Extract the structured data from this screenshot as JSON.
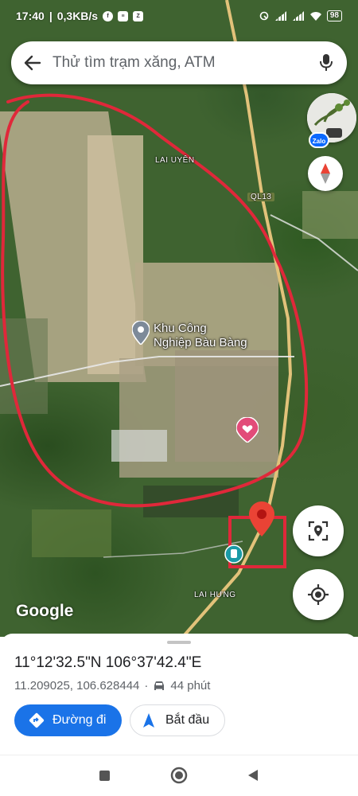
{
  "status_bar": {
    "time": "17:40",
    "network_speed": "0,3KB/s",
    "notification_icons": [
      "facebook-icon",
      "message-icon",
      "zalo-icon"
    ],
    "battery": "98"
  },
  "search": {
    "placeholder": "Thử tìm trạm xăng, ATM"
  },
  "map": {
    "labels": {
      "village_top": "LAI UYÊN",
      "highway": "QL13",
      "industrial_park": "Khu Công\nNghiệp Bàu Bàng",
      "village_bottom": "LAI HƯNG",
      "google": "Google"
    },
    "annotation_color": "#e0283a",
    "pin_color": "#ea4335"
  },
  "thumbnail": {
    "badge": "Zalo"
  },
  "place": {
    "dms": "11°12'32.5\"N 106°37'42.4\"E",
    "decimal": "11.209025, 106.628444",
    "travel_time": "44 phút"
  },
  "actions": {
    "directions_label": "Đường đi",
    "start_label": "Bắt đầu"
  },
  "colors": {
    "accent": "#1a73e8"
  }
}
